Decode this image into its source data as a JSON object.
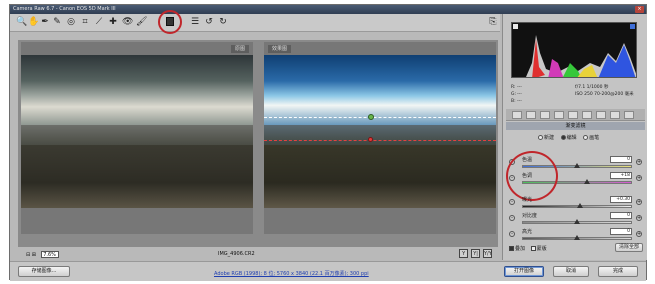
{
  "window": {
    "title": "Camera Raw 6.7 - Canon EOS 5D Mark III",
    "close": "×"
  },
  "toolbar": {
    "tools": [
      {
        "name": "zoom-tool",
        "glyph": "🔍"
      },
      {
        "name": "hand-tool",
        "glyph": "✋"
      },
      {
        "name": "white-balance-tool",
        "glyph": "✒"
      },
      {
        "name": "color-sampler-tool",
        "glyph": "✎"
      },
      {
        "name": "targeted-adjustment-tool",
        "glyph": "◎"
      },
      {
        "name": "crop-tool",
        "glyph": "⌗"
      },
      {
        "name": "straighten-tool",
        "glyph": "⟋"
      },
      {
        "name": "spot-removal-tool",
        "glyph": "✚"
      },
      {
        "name": "red-eye-tool",
        "glyph": "👁"
      },
      {
        "name": "adjustment-brush-tool",
        "glyph": "🖌"
      }
    ],
    "after_ring": [
      {
        "name": "preferences-tool",
        "glyph": "☰"
      },
      {
        "name": "rotate-left-tool",
        "glyph": "↺"
      },
      {
        "name": "rotate-right-tool",
        "glyph": "↻"
      }
    ],
    "export_glyph": "⎘"
  },
  "preview": {
    "before_label": "原图",
    "after_label": "效果图",
    "zoom_value": "7.6%",
    "filename": "IMG_4906.CR2",
    "view_buttons": [
      "Y",
      "Y|",
      "Y/Y"
    ]
  },
  "histogram": {
    "r_label": "R:",
    "g_label": "G:",
    "b_label": "B:",
    "r_value": "---",
    "g_value": "---",
    "b_value": "---",
    "camera_line1": "f/7.1   1/1000 秒",
    "camera_line2": "ISO 250   70-200@200 毫米"
  },
  "panel": {
    "section_title": "渐变滤镜",
    "modes": [
      "新建",
      "编辑",
      "画笔"
    ],
    "mode_selected": 1,
    "sliders": [
      {
        "name": "temperature",
        "label": "色温",
        "value": "0",
        "pos": 0.5
      },
      {
        "name": "tint",
        "label": "色调",
        "value": "+18",
        "pos": 0.59
      },
      {
        "name": "exposure",
        "label": "曝光",
        "value": "+0.30",
        "pos": 0.53
      },
      {
        "name": "contrast",
        "label": "对比度",
        "value": "0",
        "pos": 0.5
      },
      {
        "name": "highlights",
        "label": "高光",
        "value": "0",
        "pos": 0.5
      }
    ],
    "overlay_label": "叠加",
    "mask_label": "蒙版",
    "clear_all_label": "清除全部"
  },
  "statusbar": {
    "save_label": "存储图像...",
    "workflow_link": "Adobe RGB (1998); 8 位; 5760 x 3840 (22.1 百万像素); 300 ppi",
    "open_label": "打开图像",
    "cancel_label": "取消",
    "done_label": "完成"
  },
  "annotation_color": "#c0262b"
}
